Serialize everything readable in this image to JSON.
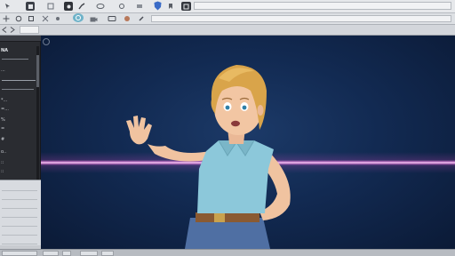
{
  "toolbar_1": {
    "icons": [
      "cursor-icon",
      "layers-icon",
      "record-icon",
      "brush-icon",
      "text-icon",
      "link-icon",
      "shield-icon",
      "window-icon"
    ]
  },
  "toolbar_2": {
    "icons": [
      "move-icon",
      "rotate-icon",
      "target-icon",
      "camera-icon",
      "light-icon",
      "material-icon",
      "bone-icon"
    ]
  },
  "left_panel": {
    "lines": [
      "NA",
      "...",
      "*...",
      "=...",
      "%",
      "=",
      "#",
      "o..",
      "::",
      "::"
    ]
  },
  "colors": {
    "viewport_bg": "#122a52",
    "laser": "#ff8cf0",
    "panel_dark": "#2a2c31",
    "toolbar": "#e6e8eb"
  }
}
